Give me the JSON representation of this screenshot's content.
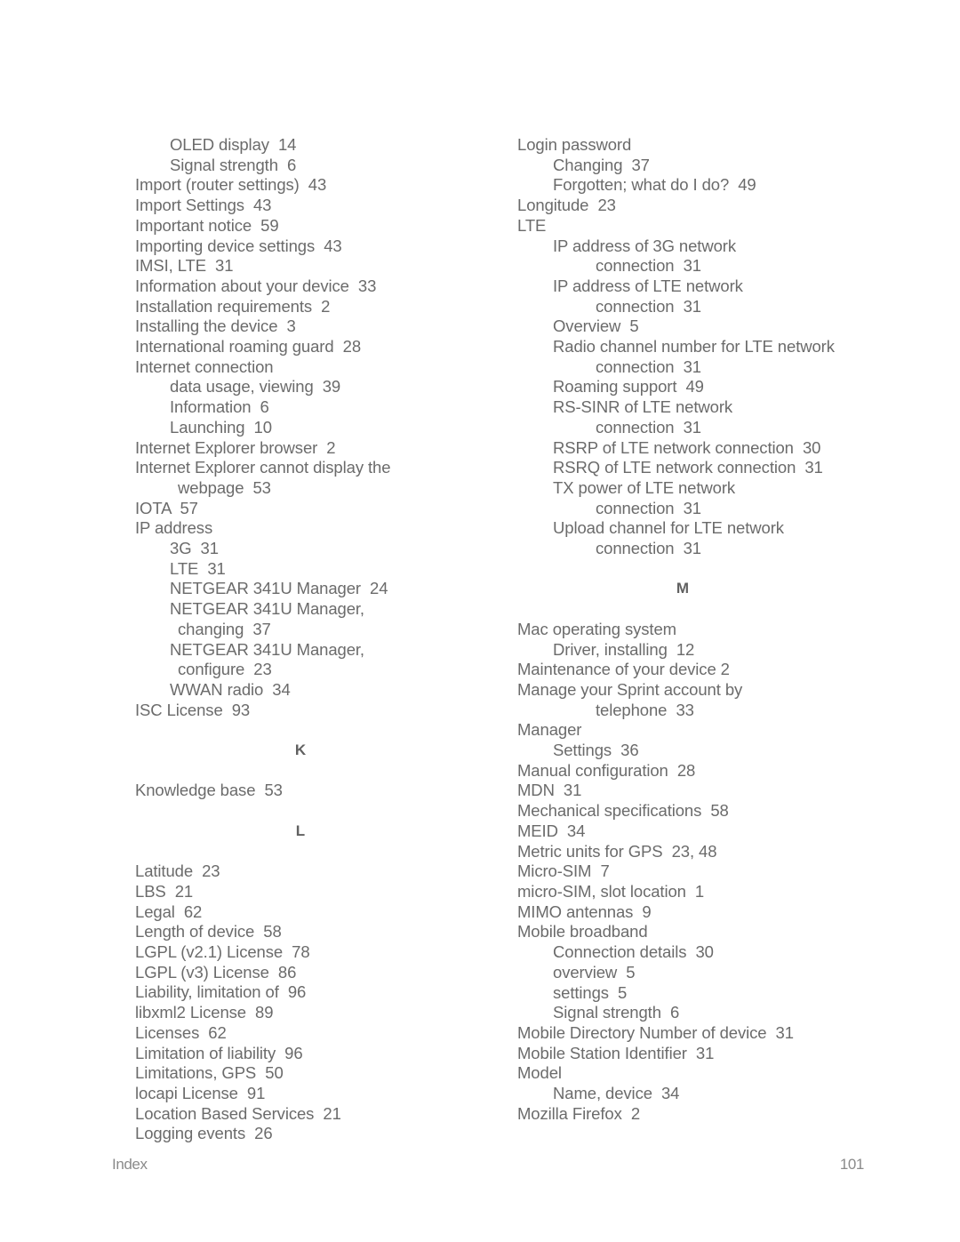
{
  "document": {
    "footer_label": "Index",
    "page_number": "101",
    "text_color": "#6b6b6b",
    "heading_color": "#616161",
    "footer_color": "#8a8a8a",
    "background": "#ffffff"
  },
  "columns": [
    {
      "name": "left-column",
      "blocks": [
        {
          "type": "entry",
          "level": 1,
          "text": "OLED display  14"
        },
        {
          "type": "entry",
          "level": 1,
          "text": "Signal strength  6"
        },
        {
          "type": "entry",
          "level": 0,
          "text": "Import (router settings)  43"
        },
        {
          "type": "entry",
          "level": 0,
          "text": "Import Settings  43"
        },
        {
          "type": "entry",
          "level": 0,
          "text": "Important notice  59"
        },
        {
          "type": "entry",
          "level": 0,
          "text": "Importing device settings  43"
        },
        {
          "type": "entry",
          "level": 0,
          "text": "IMSI, LTE  31"
        },
        {
          "type": "entry",
          "level": 0,
          "text": "Information about your device  33"
        },
        {
          "type": "entry",
          "level": 0,
          "text": "Installation requirements  2"
        },
        {
          "type": "entry",
          "level": 0,
          "text": "Installing the device  3"
        },
        {
          "type": "entry",
          "level": 0,
          "text": "International roaming guard  28"
        },
        {
          "type": "entry",
          "level": 0,
          "text": "Internet connection"
        },
        {
          "type": "entry",
          "level": 1,
          "text": "data usage, viewing  39"
        },
        {
          "type": "entry",
          "level": 1,
          "text": "Information  6"
        },
        {
          "type": "entry",
          "level": 1,
          "text": "Launching  10"
        },
        {
          "type": "entry",
          "level": 0,
          "text": "Internet Explorer browser  2"
        },
        {
          "type": "entry",
          "level": 0,
          "text": "Internet Explorer cannot display the"
        },
        {
          "type": "entry",
          "level": 2,
          "text": "webpage  53"
        },
        {
          "type": "entry",
          "level": 0,
          "text": "IOTA  57"
        },
        {
          "type": "entry",
          "level": 0,
          "text": "IP address"
        },
        {
          "type": "entry",
          "level": 1,
          "text": "3G  31"
        },
        {
          "type": "entry",
          "level": 1,
          "text": "LTE  31"
        },
        {
          "type": "entry",
          "level": 1,
          "text": "NETGEAR 341U Manager  24"
        },
        {
          "type": "entry",
          "level": 1,
          "text": "NETGEAR 341U Manager,"
        },
        {
          "type": "entry",
          "level": 2,
          "text": "changing  37"
        },
        {
          "type": "entry",
          "level": 1,
          "text": "NETGEAR 341U Manager,"
        },
        {
          "type": "entry",
          "level": 2,
          "text": "configure  23"
        },
        {
          "type": "entry",
          "level": 1,
          "text": "WWAN radio  34"
        },
        {
          "type": "entry",
          "level": 0,
          "text": "ISC License  93"
        },
        {
          "type": "heading",
          "text": "K"
        },
        {
          "type": "entry",
          "level": 0,
          "text": "Knowledge base  53"
        },
        {
          "type": "heading",
          "text": "L"
        },
        {
          "type": "entry",
          "level": 0,
          "text": "Latitude  23"
        },
        {
          "type": "entry",
          "level": 0,
          "text": "LBS  21"
        },
        {
          "type": "entry",
          "level": 0,
          "text": "Legal  62"
        },
        {
          "type": "entry",
          "level": 0,
          "text": "Length of device  58"
        },
        {
          "type": "entry",
          "level": 0,
          "text": "LGPL (v2.1) License  78"
        },
        {
          "type": "entry",
          "level": 0,
          "text": "LGPL (v3) License  86"
        },
        {
          "type": "entry",
          "level": 0,
          "text": "Liability, limitation of  96"
        },
        {
          "type": "entry",
          "level": 0,
          "text": "libxml2 License  89"
        },
        {
          "type": "entry",
          "level": 0,
          "text": "Licenses  62"
        },
        {
          "type": "entry",
          "level": 0,
          "text": "Limitation of liability  96"
        },
        {
          "type": "entry",
          "level": 0,
          "text": "Limitations, GPS  50"
        },
        {
          "type": "entry",
          "level": 0,
          "text": "locapi License  91"
        },
        {
          "type": "entry",
          "level": 0,
          "text": "Location Based Services  21"
        },
        {
          "type": "entry",
          "level": 0,
          "text": "Logging events  26"
        }
      ]
    },
    {
      "name": "right-column",
      "blocks": [
        {
          "type": "entry",
          "level": 0,
          "text": "Login password"
        },
        {
          "type": "entry",
          "level": 1,
          "text": "Changing  37"
        },
        {
          "type": "entry",
          "level": 1,
          "text": "Forgotten; what do I do?  49"
        },
        {
          "type": "entry",
          "level": 0,
          "text": "Longitude  23"
        },
        {
          "type": "entry",
          "level": 0,
          "text": "LTE"
        },
        {
          "type": "entry",
          "level": 1,
          "text": "IP address of 3G network"
        },
        {
          "type": "entry",
          "level": 2,
          "text": "connection  31"
        },
        {
          "type": "entry",
          "level": 1,
          "text": "IP address of LTE network"
        },
        {
          "type": "entry",
          "level": 2,
          "text": "connection  31"
        },
        {
          "type": "entry",
          "level": 1,
          "text": "Overview  5"
        },
        {
          "type": "entry",
          "level": 1,
          "text": "Radio channel number for LTE network"
        },
        {
          "type": "entry",
          "level": 2,
          "text": "connection  31"
        },
        {
          "type": "entry",
          "level": 1,
          "text": "Roaming support  49"
        },
        {
          "type": "entry",
          "level": 1,
          "text": "RS-SINR of LTE network"
        },
        {
          "type": "entry",
          "level": 2,
          "text": "connection  31"
        },
        {
          "type": "entry",
          "level": 1,
          "text": "RSRP of LTE network connection  30"
        },
        {
          "type": "entry",
          "level": 1,
          "text": "RSRQ of LTE network connection  31"
        },
        {
          "type": "entry",
          "level": 1,
          "text": "TX power of LTE network"
        },
        {
          "type": "entry",
          "level": 2,
          "text": "connection  31"
        },
        {
          "type": "entry",
          "level": 1,
          "text": "Upload channel for LTE network"
        },
        {
          "type": "entry",
          "level": 2,
          "text": "connection  31"
        },
        {
          "type": "heading",
          "text": "M"
        },
        {
          "type": "entry",
          "level": 0,
          "text": "Mac operating system"
        },
        {
          "type": "entry",
          "level": 1,
          "text": "Driver, installing  12"
        },
        {
          "type": "entry",
          "level": 0,
          "text": "Maintenance of your device 2"
        },
        {
          "type": "entry",
          "level": 0,
          "text": "Manage your Sprint account by"
        },
        {
          "type": "entry",
          "level": 2,
          "text": "telephone  33"
        },
        {
          "type": "entry",
          "level": 0,
          "text": "Manager"
        },
        {
          "type": "entry",
          "level": 1,
          "text": "Settings  36"
        },
        {
          "type": "entry",
          "level": 0,
          "text": "Manual configuration  28"
        },
        {
          "type": "entry",
          "level": 0,
          "text": "MDN  31"
        },
        {
          "type": "entry",
          "level": 0,
          "text": "Mechanical specifications  58"
        },
        {
          "type": "entry",
          "level": 0,
          "text": "MEID  34"
        },
        {
          "type": "entry",
          "level": 0,
          "text": "Metric units for GPS  23, 48"
        },
        {
          "type": "entry",
          "level": 0,
          "text": "Micro-SIM  7"
        },
        {
          "type": "entry",
          "level": 0,
          "text": "micro-SIM, slot location  1"
        },
        {
          "type": "entry",
          "level": 0,
          "text": "MIMO antennas  9"
        },
        {
          "type": "entry",
          "level": 0,
          "text": "Mobile broadband"
        },
        {
          "type": "entry",
          "level": 1,
          "text": "Connection details  30"
        },
        {
          "type": "entry",
          "level": 1,
          "text": "overview  5"
        },
        {
          "type": "entry",
          "level": 1,
          "text": "settings  5"
        },
        {
          "type": "entry",
          "level": 1,
          "text": "Signal strength  6"
        },
        {
          "type": "entry",
          "level": 0,
          "text": "Mobile Directory Number of device  31"
        },
        {
          "type": "entry",
          "level": 0,
          "text": "Mobile Station Identifier  31"
        },
        {
          "type": "entry",
          "level": 0,
          "text": "Model"
        },
        {
          "type": "entry",
          "level": 1,
          "text": "Name, device  34"
        },
        {
          "type": "entry",
          "level": 0,
          "text": "Mozilla Firefox  2"
        }
      ]
    }
  ]
}
